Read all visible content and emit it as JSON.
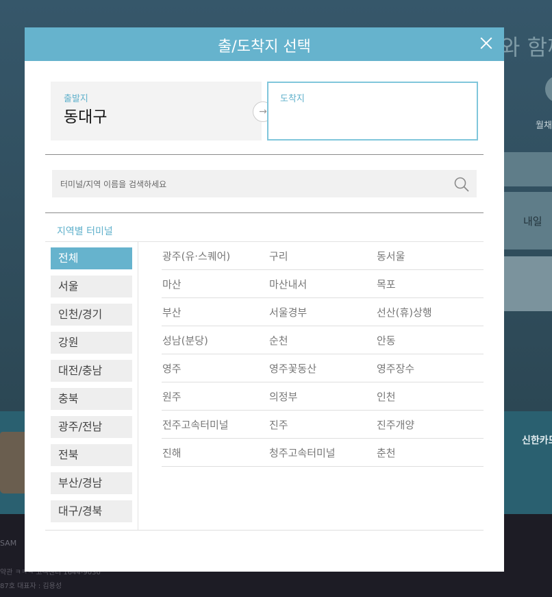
{
  "background": {
    "hero_text": "와 함께",
    "monthly_label": "월채",
    "tomorrow_label": "내일",
    "promo_text": "신한카드",
    "footer_logo": "SAM",
    "footer_links": "약관      ㅋㅋㅋ      고객센터 1644-9030",
    "footer_info": "87호 대표자 : 김용성"
  },
  "modal": {
    "title": "출/도착지 선택",
    "close_icon": "close-icon",
    "departure_label": "출발지",
    "departure_value": "동대구",
    "arrow_glyph": "→",
    "arrival_label": "도착지",
    "arrival_value": "",
    "search_placeholder": "터미널/지역 이름을 검색하세요",
    "search_icon": "search-icon",
    "section_title": "지역별 터미널",
    "accent_color": "#66b3cd",
    "regions": [
      "전체",
      "서울",
      "인천/경기",
      "강원",
      "대전/충남",
      "충북",
      "광주/전남",
      "전북",
      "부산/경남",
      "대구/경북"
    ],
    "active_region": "전체",
    "terminals": [
      [
        "광주(유·스퀘어)",
        "구리",
        "동서울"
      ],
      [
        "마산",
        "마산내서",
        "목포"
      ],
      [
        "부산",
        "서울경부",
        "선산(휴)상행"
      ],
      [
        "성남(분당)",
        "순천",
        "안동"
      ],
      [
        "영주",
        "영주꽃동산",
        "영주장수"
      ],
      [
        "원주",
        "의정부",
        "인천"
      ],
      [
        "전주고속터미널",
        "진주",
        "진주개양"
      ],
      [
        "진해",
        "청주고속터미널",
        "춘천"
      ]
    ]
  }
}
